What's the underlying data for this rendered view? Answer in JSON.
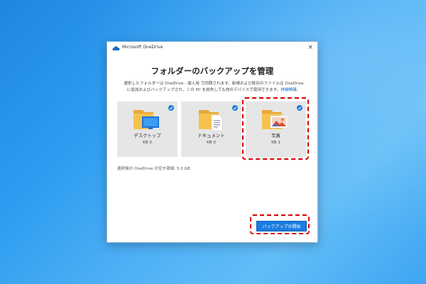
{
  "window": {
    "title": "Microsoft OneDrive",
    "close_glyph": "×"
  },
  "heading": "フォルダーのバックアップを管理",
  "description": {
    "line1": "選択したフォルダーは OneDrive - 個人用 で同期されます。新規および既存のファイルは OneDrive",
    "line2": "に追加およびバックアップされ、この PC を紛失しても他のデバイスで使用できます。",
    "link": "詳細情報",
    "link_suffix": "。"
  },
  "folders": [
    {
      "label": "デスクトップ",
      "size": "KB 0",
      "icon": "desktop-folder-icon",
      "checked": true
    },
    {
      "label": "ドキュメント",
      "size": "KB 0",
      "icon": "documents-folder-icon",
      "checked": true
    },
    {
      "label": "写真",
      "size": "KB 1",
      "icon": "pictures-folder-icon",
      "checked": true
    }
  ],
  "space_remaining": "選択後の OneDrive の空き領域: 5.0 GB",
  "start_button_label": "バックアップの開始",
  "colors": {
    "accent": "#1a7ce0",
    "highlight": "#d40000",
    "card_bg": "#e6e6e6",
    "folder": "#f6c24e"
  }
}
